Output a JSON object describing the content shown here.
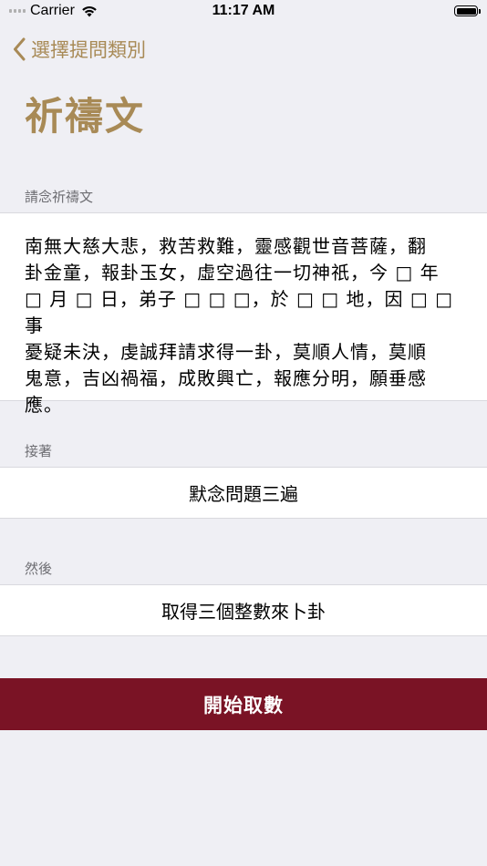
{
  "status_bar": {
    "carrier": "Carrier",
    "time": "11:17 AM",
    "icons": [
      "cellular-signal-icon",
      "wifi-icon",
      "battery-icon"
    ]
  },
  "nav": {
    "back_label": "選擇提問類別",
    "back_icon": "chevron-left-icon",
    "title": "祈禱文"
  },
  "prayer_section": {
    "header": "請念祈禱文",
    "text": "南無大慈大悲，救苦救難，靈感觀世音菩薩，翻\n卦金童，報卦玉女，虛空過往一切神祇，今 □ 年\n□ 月 □ 日，弟子 □ □ □，於 □ □ 地，因 □ □ 事\n憂疑未決，虔誠拜請求得一卦，莫順人情，莫順\n鬼意，吉凶禍福，成敗興亡，報應分明，願垂感\n應。"
  },
  "step_next": {
    "header": "接著",
    "text": "默念問題三遍"
  },
  "step_then": {
    "header": "然後",
    "text": "取得三個整數來卜卦"
  },
  "start_button": {
    "label": "開始取數"
  },
  "colors": {
    "accent": "#a88a56",
    "button_background": "#7a1325",
    "page_background": "#efeff4"
  }
}
